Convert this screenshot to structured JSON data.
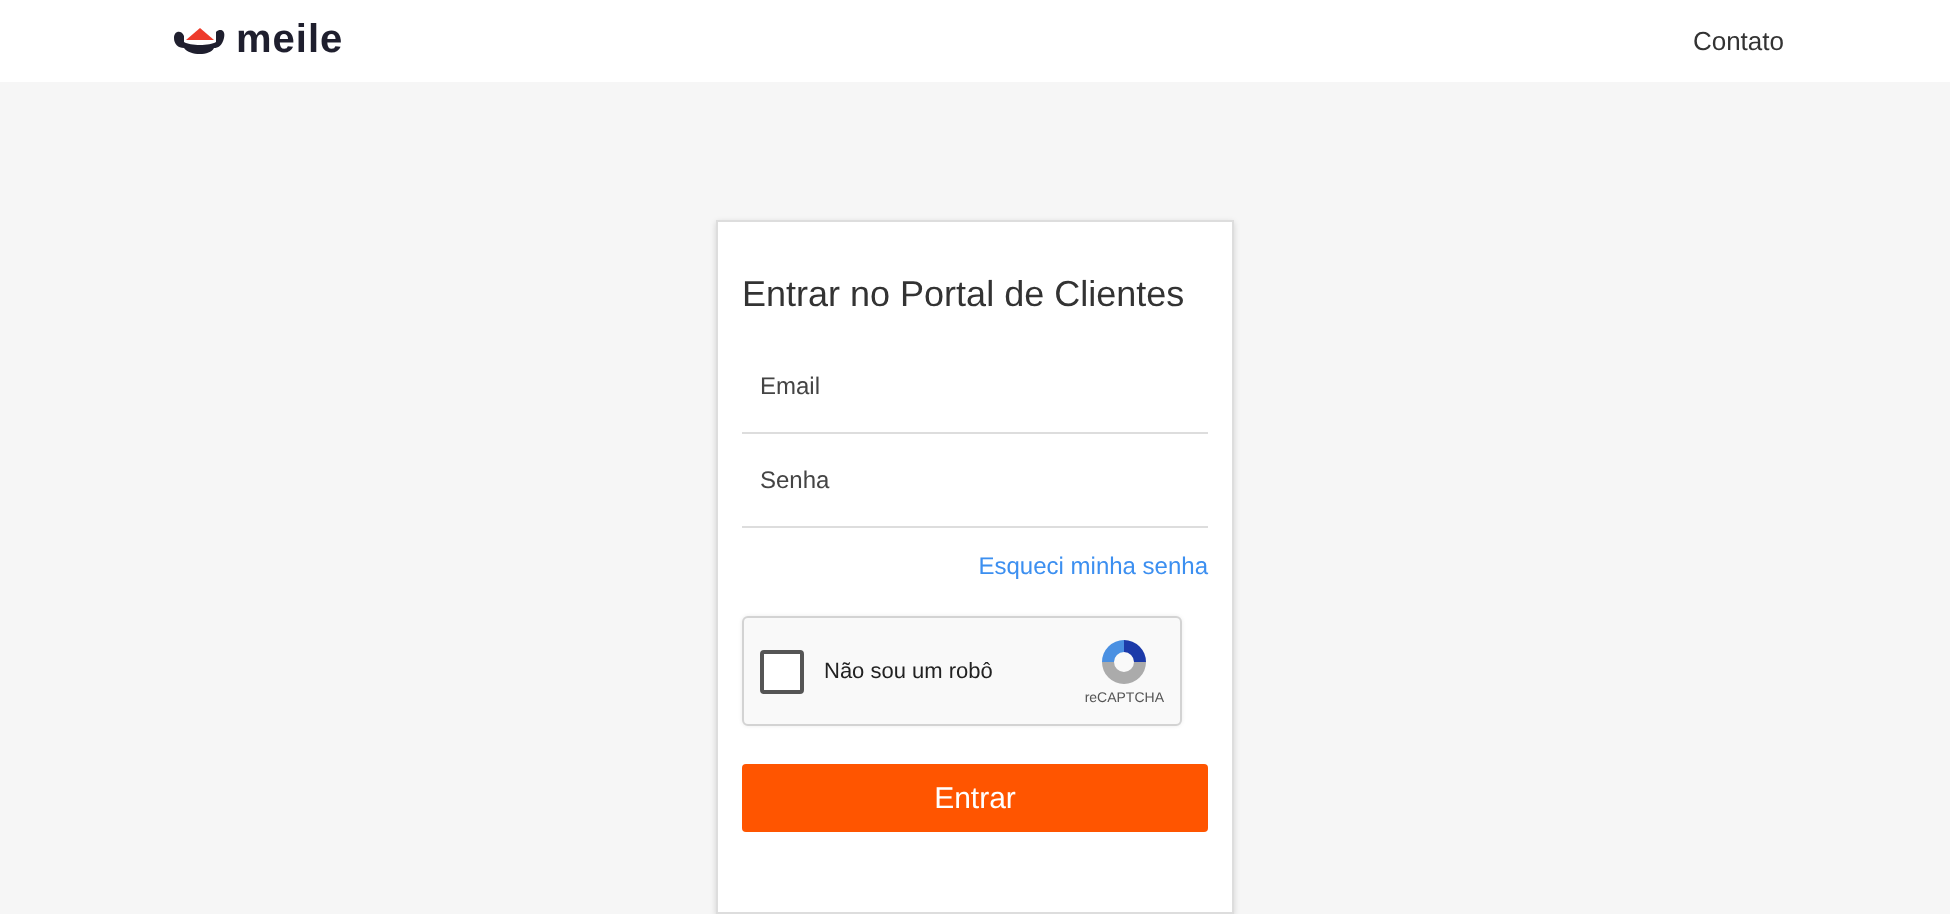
{
  "header": {
    "logo": "meile",
    "nav": [
      "Contato"
    ]
  },
  "login": {
    "title": "Entrar no Portal de Clientes",
    "fields": [
      {
        "placeholder": "Email"
      },
      {
        "placeholder": "Senha"
      }
    ],
    "forgot_link": "Esqueci minha senha",
    "captcha": {
      "label": "Não sou um robô",
      "brand": "reCAPTCHA",
      "checked": false
    },
    "submit": "Entrar"
  }
}
